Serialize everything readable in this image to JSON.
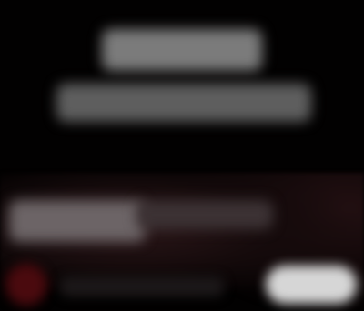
{
  "screen": {
    "background": "#020101",
    "accent_glow": "#2a1618"
  },
  "content": {
    "headline": "",
    "subheadline": "",
    "body": ""
  },
  "footer": {
    "avatar_color": "#4a0a0e",
    "channel_name": "",
    "action_label": ""
  }
}
